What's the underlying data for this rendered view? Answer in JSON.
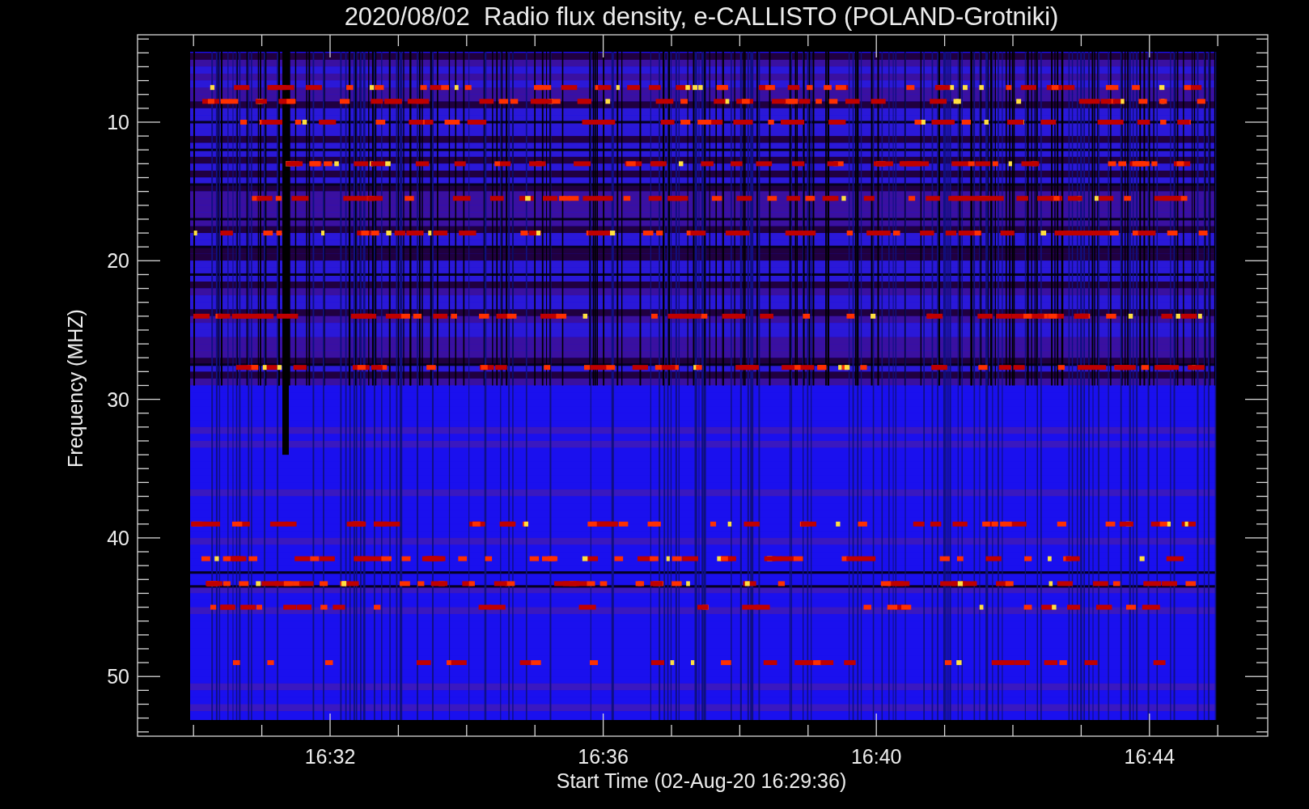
{
  "title": "2020/08/02  Radio flux density, e-CALLISTO (POLAND-Grotniki)",
  "y_axis": {
    "label": "Frequency (MHZ)",
    "ticks": [
      "10",
      "20",
      "30",
      "40",
      "50"
    ]
  },
  "x_axis": {
    "label": "Start Time (02-Aug-20 16:29:36)",
    "ticks": [
      "16:32",
      "16:36",
      "16:40",
      "16:44"
    ]
  }
}
